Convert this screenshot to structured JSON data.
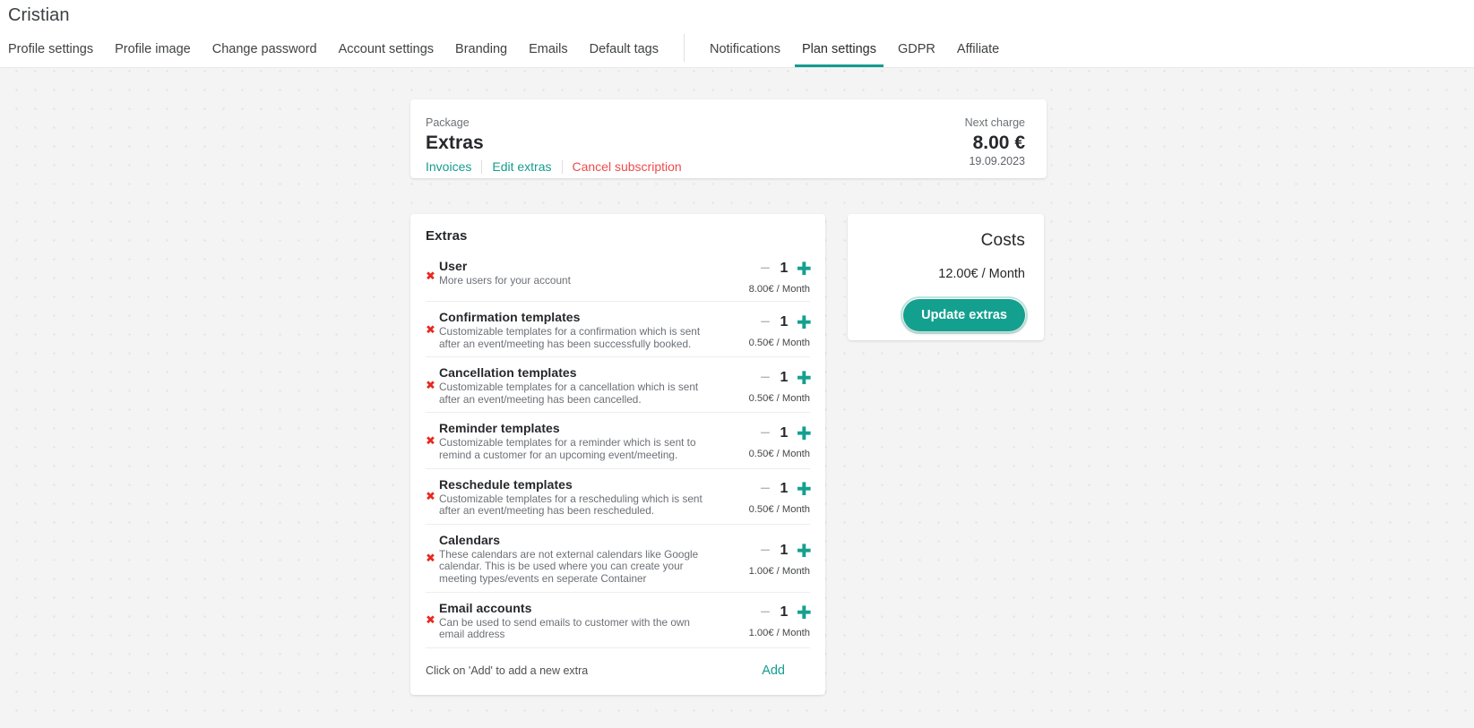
{
  "header": {
    "title": "Cristian",
    "tabs": [
      {
        "label": "Profile settings",
        "active": false
      },
      {
        "label": "Profile image",
        "active": false
      },
      {
        "label": "Change password",
        "active": false
      },
      {
        "label": "Account settings",
        "active": false
      },
      {
        "label": "Branding",
        "active": false
      },
      {
        "label": "Emails",
        "active": false
      },
      {
        "label": "Default tags",
        "active": false
      },
      {
        "label": "Notifications",
        "active": false
      },
      {
        "label": "Plan settings",
        "active": true
      },
      {
        "label": "GDPR",
        "active": false
      },
      {
        "label": "Affiliate",
        "active": false
      }
    ]
  },
  "package": {
    "label": "Package",
    "name": "Extras",
    "links": [
      {
        "label": "Invoices",
        "style": "normal"
      },
      {
        "label": "Edit extras",
        "style": "normal"
      },
      {
        "label": "Cancel subscription",
        "style": "danger"
      }
    ],
    "next_charge_label": "Next charge",
    "next_charge_amount": "8.00 €",
    "next_charge_date": "19.09.2023"
  },
  "extras": {
    "title": "Extras",
    "remove_icon": "✖",
    "minus_icon": "−",
    "plus_icon": "✚",
    "items": [
      {
        "name": "User",
        "description": "More users for your account",
        "quantity": "1",
        "price": "8.00€ / Month"
      },
      {
        "name": "Confirmation templates",
        "description": "Customizable templates for a confirmation which is sent after an event/meeting has been successfully booked.",
        "quantity": "1",
        "price": "0.50€ / Month"
      },
      {
        "name": "Cancellation templates",
        "description": "Customizable templates for a cancellation which is sent after an event/meeting has been cancelled.",
        "quantity": "1",
        "price": "0.50€ / Month"
      },
      {
        "name": "Reminder templates",
        "description": "Customizable templates for a reminder which is sent to remind a customer for an upcoming event/meeting.",
        "quantity": "1",
        "price": "0.50€ / Month"
      },
      {
        "name": "Reschedule templates",
        "description": "Customizable templates for a rescheduling which is sent after an event/meeting has been rescheduled.",
        "quantity": "1",
        "price": "0.50€ / Month"
      },
      {
        "name": "Calendars",
        "description": "These calendars are not external calendars like Google calendar. This is be used where you can create your meeting types/events en seperate Container",
        "quantity": "1",
        "price": "1.00€ / Month"
      },
      {
        "name": "Email accounts",
        "description": "Can be used to send emails to customer with the own email address",
        "quantity": "1",
        "price": "1.00€ / Month"
      }
    ],
    "footer_hint": "Click on 'Add' to add a new extra",
    "add_label": "Add"
  },
  "costs": {
    "title": "Costs",
    "amount": "12.00€ / Month",
    "update_label": "Update extras"
  },
  "colors": {
    "accent": "#14a08f",
    "danger": "#ef4b4b",
    "remove": "#e8291f",
    "text": "#26282b",
    "muted": "#6c7075"
  }
}
